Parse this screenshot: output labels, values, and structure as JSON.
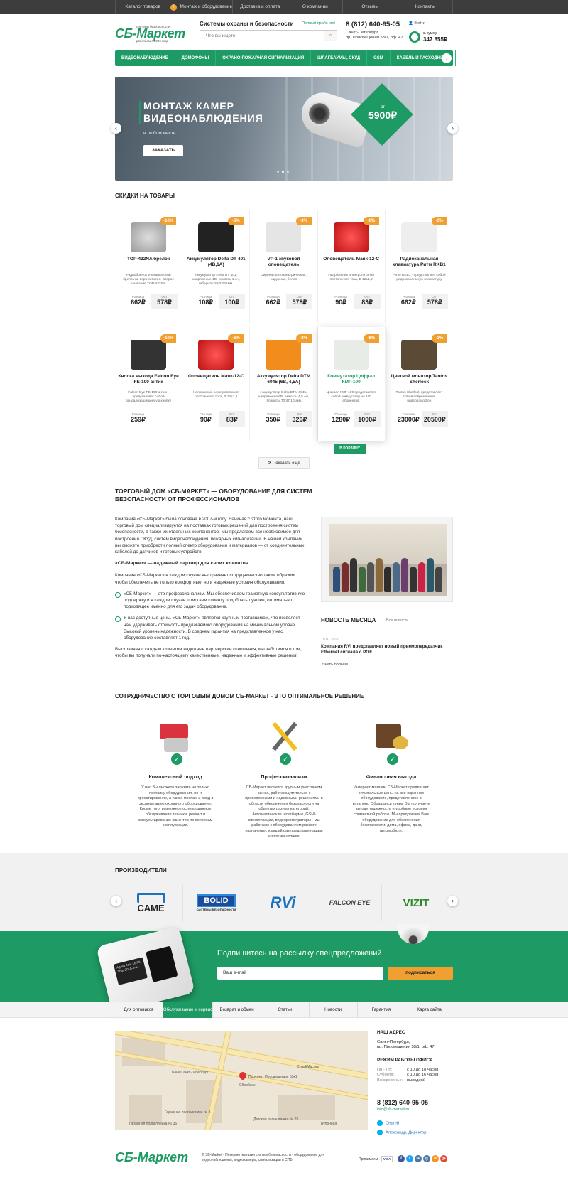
{
  "top_nav": [
    "Каталог товаров",
    "Монтаж и оборудование",
    "Доставка и оплата",
    "О компании",
    "Отзывы",
    "Контакты"
  ],
  "top_nav_badge": "!",
  "logo": {
    "name": "СБ-Маркет",
    "sub": "системы безопасности",
    "since": "работаем с 2006 года"
  },
  "tagline": "Системы охраны и безопасности",
  "price_link": "Полный прайс xml",
  "search_placeholder": "Что вы ищете",
  "phone": "8 (812) 640-95-05",
  "address_line1": "Санкт-Петербург,",
  "address_line2": "пр. Просвещения 53/1, оф. 47",
  "login": "Войти",
  "cart_label": "на сумму",
  "cart_sum": "347 855₽",
  "main_nav": [
    "ВИДЕОНАБЛЮДЕНИЕ",
    "ДОМОФОНЫ",
    "ОХРАНО-ПОЖАРНАЯ СИГНАЛИЗАЦИЯ",
    "ШЛАГБАУМЫ, СКУД",
    "GSM",
    "КАБЕЛЬ И РАСХОДНИКИ"
  ],
  "hero": {
    "title": "МОНТАЖ КАМЕР ВИДЕОНАБЛЮДЕНИЯ",
    "subtitle": "в любом месте",
    "button": "ЗАКАЗАТЬ",
    "price_from": "от",
    "price": "5900₽"
  },
  "discounts_title": "СКИДКИ НА ТОВАРЫ",
  "price_retail_label": "Розница",
  "price_opt_label": "Опт",
  "to_cart": "В КОРЗИНУ",
  "products_row1": [
    {
      "name": "TOP-432NA брелок",
      "badge": "-10%",
      "desc": "Радиобрелок 2-х канальный брелок на ворота Came. Старое название TOP-432SA",
      "retail": "662₽",
      "opt": "578₽"
    },
    {
      "name": "Аккумулятор Delta DT 401 (4В,1А)",
      "badge": "-6%",
      "desc": "Аккумулятор Delta DT 401, напряжение 4В, емкость 1 Ач, габариты 35/22/61мм.",
      "retail": "108₽",
      "opt": "100₽"
    },
    {
      "name": "VP-1 звуковой оповещатель",
      "badge": "-3%",
      "desc": "Сирена пьезоэлектрическая, наружная, белая",
      "retail": "662₽",
      "opt": "578₽"
    },
    {
      "name": "Оповещатель Маяк-12-С",
      "badge": "-6%",
      "desc": "Напряжение электропитания постоянного тока, В 12±1,2",
      "retail": "90₽",
      "opt": "83₽"
    },
    {
      "name": "Радиоканальная клавиатура Ритм RKB1",
      "badge": "-3%",
      "desc": "Ритм RKB1 - представляет собой радиоканальную клавиатуру",
      "retail": "662₽",
      "opt": "578₽"
    }
  ],
  "products_row2": [
    {
      "name": "Кнопка выхода Falcon Eye FE-100 антик",
      "badge": "-10%",
      "desc": "Falcon Eye FE-100 антик - представляет собой вандалозащищенную кнопку",
      "retail": "259₽",
      "opt": ""
    },
    {
      "name": "Оповещатель Маяк-12-С",
      "badge": "-6%",
      "desc": "Напряжение электропитания постоянного тока, В 12±1,2",
      "retail": "90₽",
      "opt": "83₽"
    },
    {
      "name": "Аккумулятор Delta DTM 6045 (6В, 4,5А)",
      "badge": "-3%",
      "desc": "Аккумулятор Delta DTM 6045, напряжение 6В, емкость 4,5 Ач, габариты 70/47/101мм.",
      "retail": "350₽",
      "opt": "320₽"
    },
    {
      "name": "Коммутатор Цифрал КМГ-100",
      "badge": "-8%",
      "desc": "Цифрал КМГ-100 представляет собой коммутатор на 100 абонентов.",
      "retail": "1280₽",
      "opt": "1000₽"
    },
    {
      "name": "Цветной монитор Tantos Sherlock",
      "badge": "-2%",
      "desc": "Tantos Sherlock представляет собой современный видеодомофон",
      "retail": "23000₽",
      "opt": "20500₽"
    }
  ],
  "show_more": "Показать еще",
  "about_title": "ТОРГОВЫЙ ДОМ «СБ-МАРКЕТ» — ОБОРУДОВАНИЕ ДЛЯ СИСТЕМ БЕЗОПАСНОСТИ ОТ ПРОФЕССИОНАЛОВ",
  "about_p1": "Компания «СБ-Маркет» была основана в 2007-м году. Начиная с этого момента, наш торговый дом специализируется на поставках готовых решений для построения систем безопасности, а также их отдельных компонентов. Мы предлагаем все необходимое для построения СКУД, систем видеонаблюдения, пожарных сигнализаций. В нашей компании вы сможете приобрести полный спектр оборудования и материалов — от соединительных кабелей до датчиков и готовых устройств.",
  "about_sub": "«СБ-Маркет» — надежный партнер для своих клиентов",
  "about_p2": "Компания «СБ-Маркет» в каждом случае выстраивает сотрудничество таким образом, чтобы обеспечить не только комфортные, но и надежные условия обслуживания.",
  "about_li1": "«СБ-Маркет» — это профессионализм. Мы обеспечиваем грамотную консультативную поддержку и в каждом случае помогаем клиенту подобрать лучшее, оптимально подходящее именно для его задач оборудование.",
  "about_li2": "У нас доступные цены. «СБ-Маркет» является крупным поставщиком, что позволяет нам удерживать стоимость предлагаемого оборудования на минимальном уровне. Высокий уровень надежности. В среднем гарантия на представленное у нас оборудование составляет 1 год.",
  "about_p3": "Выстраивая с каждым клиентом надежные партнерские отношения, мы заботимся о том, чтобы вы получали по-настоящему качественные, надежные и эффективные решения!",
  "news": {
    "title": "НОВОСТЬ МЕСЯЦА",
    "all": "Все новости",
    "date": "10.07.2017",
    "headline": "Компания RVi представляет новый приемопередатчик Ethernet сигнала с POE!",
    "more": "Узнать больше"
  },
  "coop_title": "СОТРУДНИЧЕСТВО С ТОРГОВЫМ ДОМОМ СБ-МАРКЕТ - ЭТО ОПТИМАЛЬНОЕ РЕШЕНИЕ",
  "features": [
    {
      "title": "Комплексный подход",
      "text": "У нас Вы сможете заказать не только поставку оборудования, но и проектирование, а также монтаж и ввод в эксплуатацию охранного оборудования. Кроме того, возможно послепродажное обслуживание техники, ремонт и консультирование клиентов по вопросам эксплуатации."
    },
    {
      "title": "Профессионализм",
      "text": "СБ-Маркет является крупным участником рынка, работающим только с проверенными и надежными решениями в области обеспечения безопасности на объектах разных категорий. Автоматические шлагбаумы, GSM-сигнализации, видеорегистраторы - мы работаем с оборудованием разного назначения, каждый раз предлагая нашим клиентам лучшее."
    },
    {
      "title": "Финансовая выгода",
      "text": "Интернет-магазин СБ-Маркет предлагает оптимальные цены на все охранное оборудование, представленное в каталоге. Обращаясь к нам, Вы получаете выгоду, надежность и удобные условия совместной работы. Мы предлагаем Вам оборудование для обеспечения безопасности: дома, офиса, дачи, автомобиля."
    }
  ],
  "brands_title": "ПРОИЗВОДИТЕЛИ",
  "brands": [
    "CAME",
    "BOLID",
    "RVi",
    "FALCON EYE",
    "VIZIT"
  ],
  "bolid_sub": "СИСТЕМЫ БЕЗОПАСНОСТИ",
  "subscribe": {
    "title": "Подпишитесь на рассылку спецпредложений",
    "placeholder": "Ваш e-mail",
    "button": "подписаться"
  },
  "device_screen": "Agosy Arm 16:03 Thur 2018-6-14",
  "bottom_nav": [
    "Для оптовиков",
    "Обслуживание и сервис",
    "Возврат и обмен",
    "Статьи",
    "Новости",
    "Гарантия",
    "Карта сайта"
  ],
  "map_labels": [
    "Проспект Просвещения, 53к1",
    "Сбербанк",
    "Банк Санкт-Петербург",
    "Гаражная поликлиника № 8",
    "Детская поликлиника № 25",
    "Гаражная поликлиника № 36",
    "Булочная",
    "СтройМастер"
  ],
  "contacts": {
    "address_title": "НАШ АДРЕС",
    "address1": "Санкт-Петербург,",
    "address2": "пр. Просвещения 53/1, оф. 47",
    "hours_title": "РЕЖИМ РАБОТЫ ОФИСА",
    "hours": [
      [
        "Пн - Пт:",
        "с 10 до 18 часов"
      ],
      [
        "Суббота:",
        "с 10 до 16 часов"
      ],
      [
        "Воскресенье:",
        "выходной"
      ]
    ],
    "phone": "8 (812) 640-95-05",
    "email": "info@sb-market.ru",
    "skype1": "Сергей",
    "skype2": "Александр, Директор"
  },
  "footer": {
    "copy": "© SB-Market - Интернет-магазин систем безопасности - оборудование для видеонаблюдения, видеокамеры, сигнализации в СПБ",
    "accept": "Принимаем",
    "visa": "VISA",
    "social": [
      "f",
      "t",
      "vk",
      "g",
      "o",
      "g+"
    ]
  },
  "colors": {
    "brand": "#1e9a64",
    "accent": "#f0a030",
    "dark": "#3d3d3d"
  }
}
